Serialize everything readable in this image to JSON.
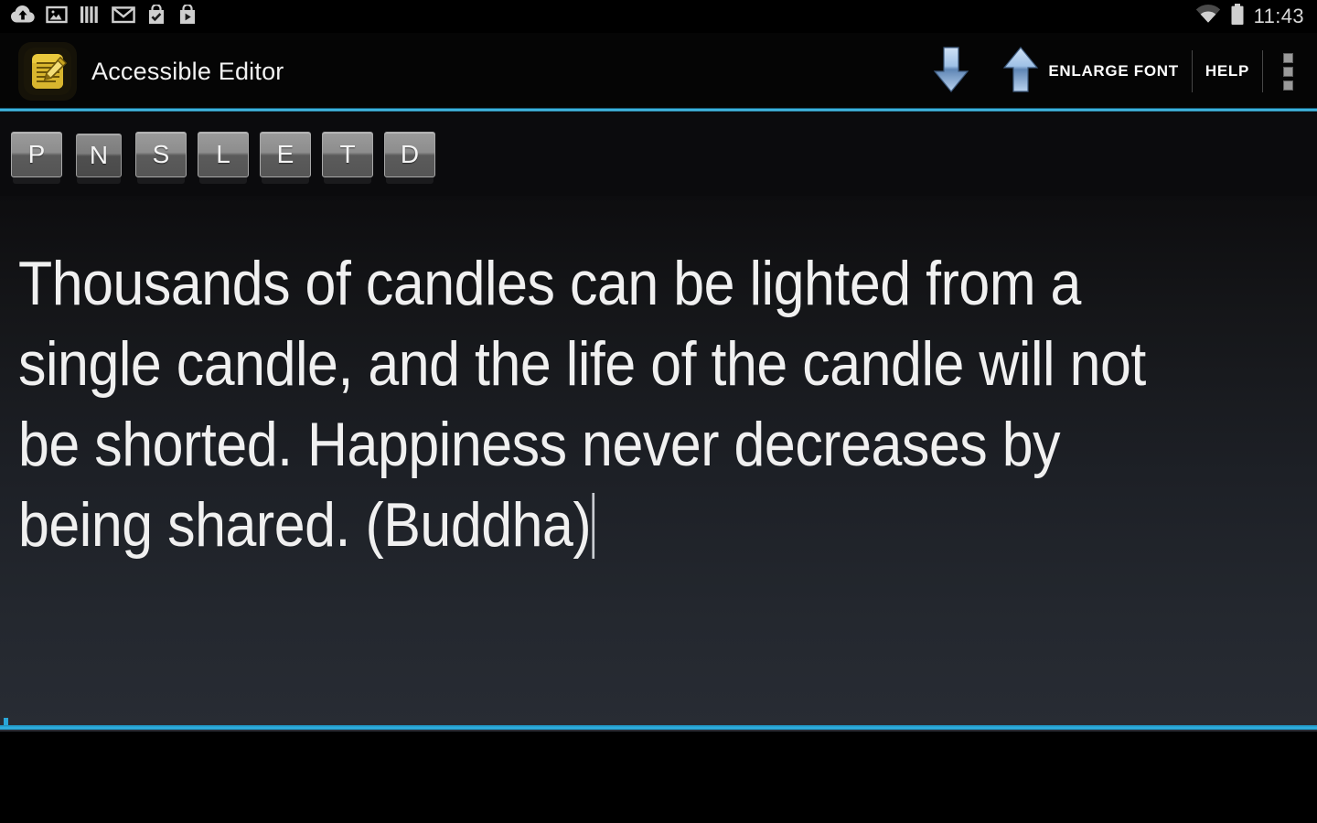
{
  "status_bar": {
    "icons": [
      {
        "name": "cloud-upload-icon",
        "label": "Backup upload"
      },
      {
        "name": "image-icon",
        "label": "Screenshot captured"
      },
      {
        "name": "equalizer-icon",
        "label": "Media playing"
      },
      {
        "name": "gmail-icon",
        "label": "New mail"
      },
      {
        "name": "play-store-update-icon",
        "label": "App updated"
      },
      {
        "name": "play-store-download-icon",
        "label": "App downloading"
      }
    ],
    "wifi": "wifi-icon",
    "battery": "battery-icon",
    "clock": "11:43"
  },
  "action_bar": {
    "app_icon": "notepad-pencil-icon",
    "title": "Accessible Editor",
    "shrink_font": {
      "icon": "arrow-down-icon",
      "label": ""
    },
    "enlarge_font": {
      "icon": "arrow-up-icon",
      "label": "ENLARGE FONT"
    },
    "help": {
      "label": "HELP"
    },
    "overflow": {
      "icon": "overflow-menu-icon",
      "label": "More options"
    }
  },
  "tool_row": {
    "buttons": [
      {
        "glyph": "P",
        "name": "paragraph-button",
        "state": "normal"
      },
      {
        "glyph": "N",
        "name": "new-button",
        "state": "pressed"
      },
      {
        "glyph": "S",
        "name": "save-button",
        "state": "normal"
      },
      {
        "glyph": "L",
        "name": "load-button",
        "state": "normal"
      },
      {
        "glyph": "E",
        "name": "edit-button",
        "state": "normal"
      },
      {
        "glyph": "T",
        "name": "text-button",
        "state": "normal"
      },
      {
        "glyph": "D",
        "name": "delete-button",
        "state": "normal"
      }
    ]
  },
  "editor": {
    "content": "Thousands of candles can be lighted from a single candle, and the life of the candle will not be shorted. Happiness never decreases by being shared. (Buddha)",
    "caret_visible": true,
    "focused": true
  },
  "colors": {
    "accent": "#33b5e5",
    "app_icon_gold": "#e8c63a",
    "editor_bg_top": "#0d0d0f",
    "editor_bg_bottom": "#282c34",
    "text": "#f0f0f0",
    "action_bar_bg": "#050505",
    "arrow_blue": "#8fb6e0"
  }
}
